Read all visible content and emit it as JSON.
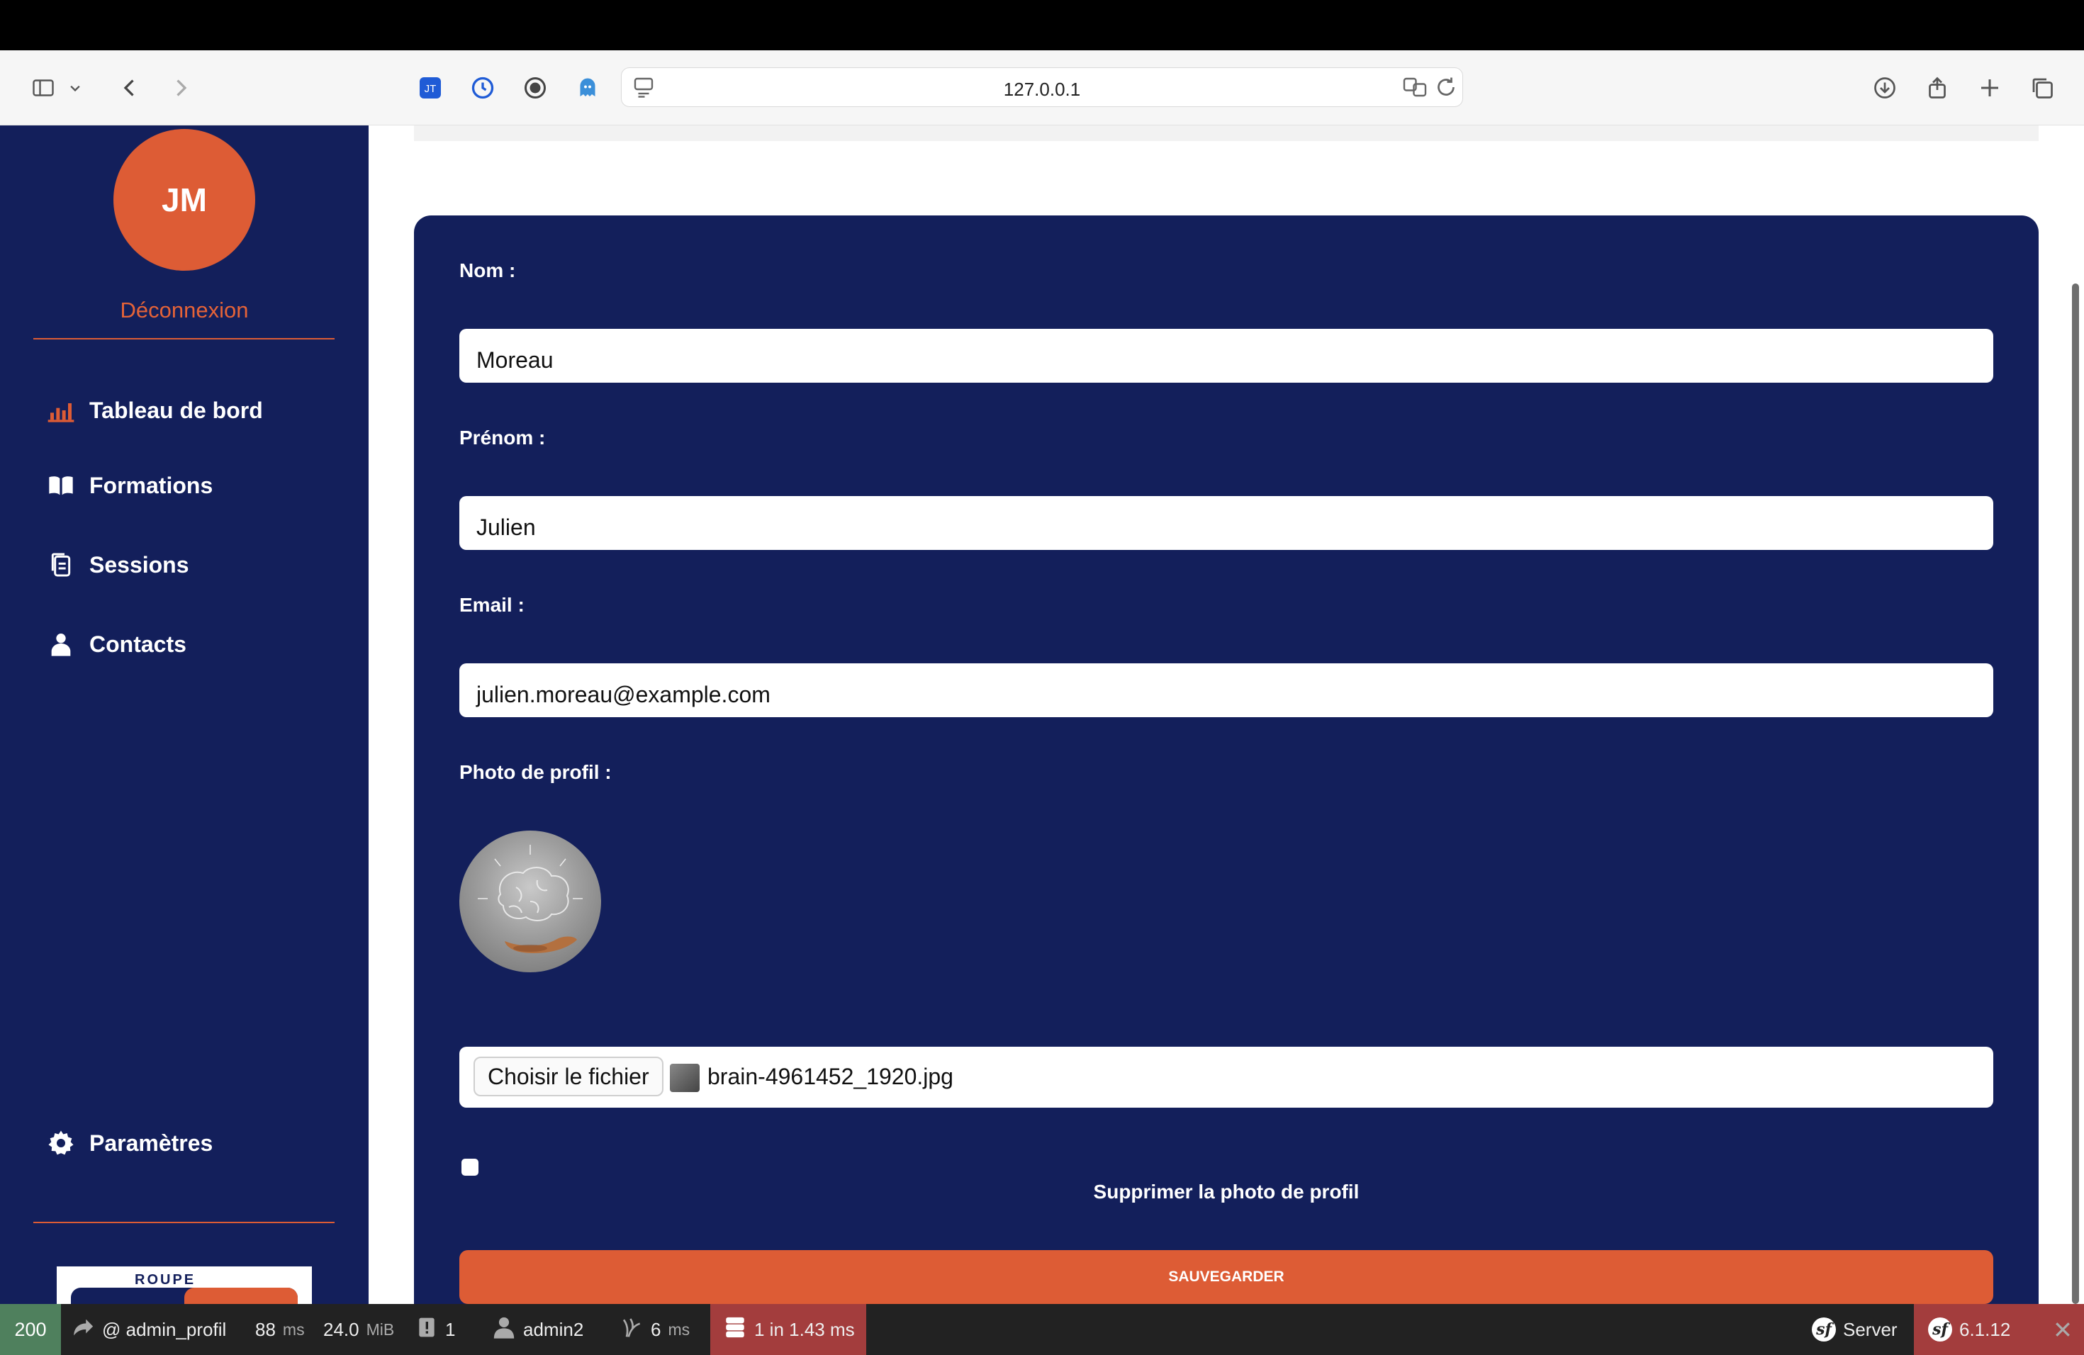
{
  "browser": {
    "url": "127.0.0.1"
  },
  "sidebar": {
    "avatar_initials": "JM",
    "logout_label": "Déconnexion",
    "items": [
      {
        "label": "Tableau de bord",
        "icon": "bar-chart-icon"
      },
      {
        "label": "Formations",
        "icon": "book-open-icon"
      },
      {
        "label": "Sessions",
        "icon": "documents-icon"
      },
      {
        "label": "Contacts",
        "icon": "person-icon"
      }
    ],
    "settings_label": "Paramètres",
    "logo_text": "ROUPE"
  },
  "form": {
    "nom_label": "Nom :",
    "nom_value": "Moreau",
    "prenom_label": "Prénom :",
    "prenom_value": "Julien",
    "email_label": "Email :",
    "email_value": "julien.moreau@example.com",
    "photo_label": "Photo de profil :",
    "file_button_label": "Choisir le fichier",
    "file_name": "brain-4961452_1920.jpg",
    "delete_photo_label": "Supprimer la photo de profil",
    "save_label": "SAUVEGARDER"
  },
  "debug_toolbar": {
    "status_code": "200",
    "route": "@ admin_profil",
    "time_value": "88",
    "time_unit": "ms",
    "memory_value": "24.0",
    "memory_unit": "MiB",
    "logs_count": "1",
    "user": "admin2",
    "twig_value": "6",
    "twig_unit": "ms",
    "db_summary": "1 in 1.43 ms",
    "server_label": "Server",
    "symfony_version": "6.1.12"
  },
  "colors": {
    "sidebar_bg": "#131f5b",
    "accent": "#dd5c35",
    "toolbar_bg": "#222222",
    "status_ok": "#4f805d",
    "db_highlight": "#a33d3d"
  }
}
